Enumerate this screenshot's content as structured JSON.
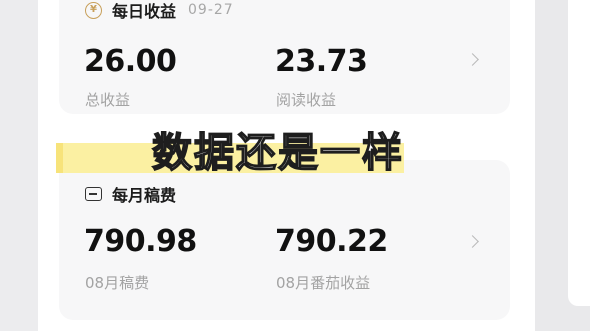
{
  "daily": {
    "title": "每日收益",
    "date": "09-27",
    "icon": "coin-icon",
    "total_value": "26.00",
    "total_label": "总收益",
    "reading_value": "23.73",
    "reading_label": "阅读收益"
  },
  "monthly": {
    "title": "每月稿费",
    "icon": "wallet-icon",
    "fee_value": "790.98",
    "fee_label": "08月稿费",
    "fanqie_value": "790.22",
    "fanqie_label": "08月番茄收益"
  },
  "caption": {
    "text": "数据还是一样"
  },
  "colors": {
    "highlight": "#fbf0a2",
    "accent_gold": "#c8a05b",
    "muted_text": "#a3a3a3"
  }
}
